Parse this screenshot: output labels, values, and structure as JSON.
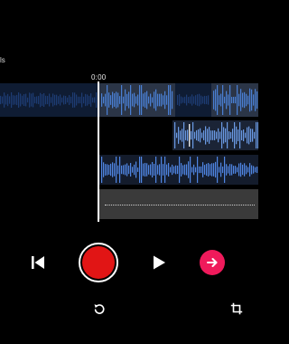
{
  "timeline": {
    "edge_label": "ls",
    "playhead_time": "0:00"
  },
  "tracks": [
    {
      "id": "track-1",
      "color": "#4a7fd4",
      "background": "#0f1c33",
      "selected_background": "#2b3547"
    },
    {
      "id": "track-2",
      "color": "#6b9be6",
      "background": "#1b2436"
    },
    {
      "id": "track-3",
      "color": "#4f86e3",
      "background": "#141c2c"
    },
    {
      "id": "track-4",
      "color": "#d0d0d0",
      "background": "#3a3a3a"
    }
  ],
  "controls": {
    "rewind_icon": "skip-back-icon",
    "record_icon": "record-icon",
    "play_icon": "play-icon",
    "next_icon": "arrow-right-icon",
    "record_color": "#e11515",
    "next_color": "#ef1a5b",
    "undo_icon": "undo-icon",
    "crop_icon": "crop-icon"
  }
}
